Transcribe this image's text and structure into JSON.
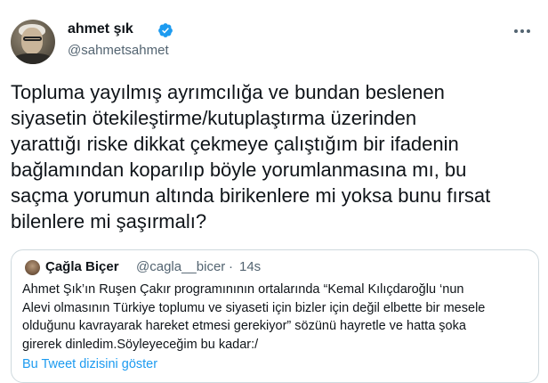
{
  "author": {
    "name": "ahmet şık",
    "handle": "@sahmetsahmet",
    "verified": true
  },
  "tweet": {
    "text": "Topluma yayılmış ayrımcılığa ve bundan beslenen\nsiyasetin ötekileştirme/kutuplaştırma üzerinden\nyarattığı riske dikkat çekmeye çalıştığım bir ifadenin\nbağlamından koparılıp böyle yorumlanmasına mı, bu\nsaçma yorumun altında birikenlere mi yoksa bunu fırsat\nbilenlere mi şaşırmalı?"
  },
  "quoted": {
    "name": "Çağla Biçer",
    "handle": "@cagla__bicer",
    "separator": "·",
    "time": "14s",
    "text": "Ahmet Şık’ın Ruşen Çakır programınının ortalarında “Kemal Kılıçdaroğlu ‘nun\nAlevi olmasının Türkiye toplumu ve siyaseti için bizler için değil elbette bir mesele\nolduğunu kavrayarak hareket etmesi gerekiyor” sözünü hayretle ve hatta şoka\ngirerek dinledim.Söyleyeceğim bu kadar:/",
    "thread_link": "Bu Tweet dizisini göster"
  },
  "colors": {
    "text": "#0f1419",
    "secondary": "#536471",
    "link": "#1d9bf0",
    "border": "#cfd9de"
  },
  "icons": [
    "avatar",
    "verified-badge-icon",
    "more-options-icon"
  ]
}
